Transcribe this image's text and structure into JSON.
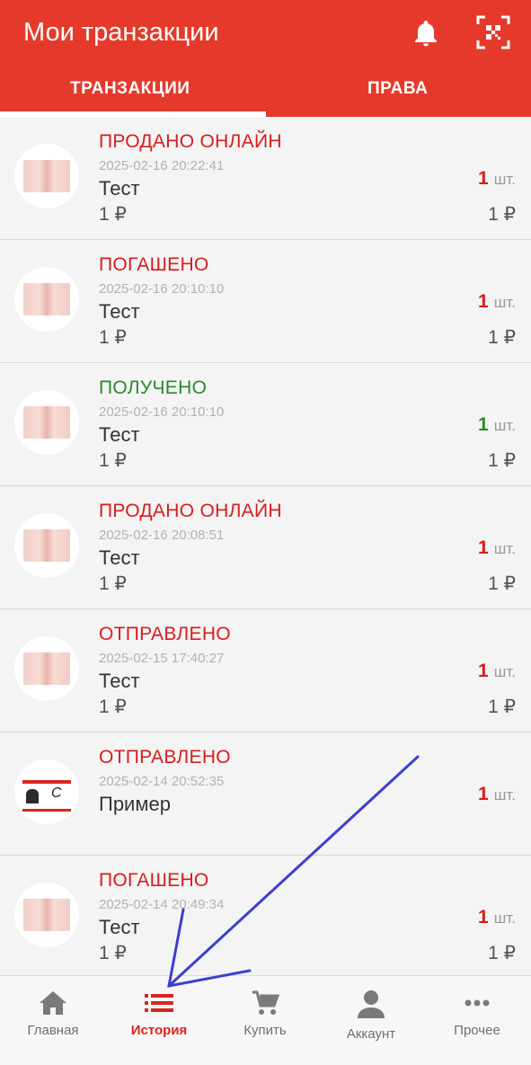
{
  "header": {
    "title": "Мои транзакции",
    "icons": [
      "bell-icon",
      "qr-scan-icon"
    ],
    "accent_color": "#e53a2b"
  },
  "tabs": [
    {
      "label": "ТРАНЗАКЦИИ",
      "active": true
    },
    {
      "label": "ПРАВА",
      "active": false
    }
  ],
  "transactions": [
    {
      "status": "ПРОДАНО ОНЛАЙН",
      "status_color": "red",
      "date": "2025-02-16 20:22:41",
      "name": "Тест",
      "price": "1 ₽",
      "qty": "1",
      "unit": "шт.",
      "total": "1 ₽",
      "thumb": "image"
    },
    {
      "status": "ПОГАШЕНО",
      "status_color": "red",
      "date": "2025-02-16 20:10:10",
      "name": "Тест",
      "price": "1 ₽",
      "qty": "1",
      "unit": "шт.",
      "total": "1 ₽",
      "thumb": "image"
    },
    {
      "status": "ПОЛУЧЕНО",
      "status_color": "green",
      "date": "2025-02-16 20:10:10",
      "name": "Тест",
      "price": "1 ₽",
      "qty": "1",
      "unit": "шт.",
      "total": "1 ₽",
      "thumb": "image"
    },
    {
      "status": "ПРОДАНО ОНЛАЙН",
      "status_color": "red",
      "date": "2025-02-16 20:08:51",
      "name": "Тест",
      "price": "1 ₽",
      "qty": "1",
      "unit": "шт.",
      "total": "1 ₽",
      "thumb": "image"
    },
    {
      "status": "ОТПРАВЛЕНО",
      "status_color": "red",
      "date": "2025-02-15 17:40:27",
      "name": "Тест",
      "price": "1 ₽",
      "qty": "1",
      "unit": "шт.",
      "total": "1 ₽",
      "thumb": "image"
    },
    {
      "status": "ОТПРАВЛЕНО",
      "status_color": "red",
      "date": "2025-02-14 20:52:35",
      "name": "Пример",
      "price": "",
      "qty": "1",
      "unit": "шт.",
      "total": "",
      "thumb": "banner"
    },
    {
      "status": "ПОГАШЕНО",
      "status_color": "red",
      "date": "2025-02-14 20:49:34",
      "name": "Тест",
      "price": "1 ₽",
      "qty": "1",
      "unit": "шт.",
      "total": "1 ₽",
      "thumb": "image"
    }
  ],
  "bottom_nav": [
    {
      "label": "Главная",
      "icon": "home-icon",
      "active": false
    },
    {
      "label": "История",
      "icon": "list-icon",
      "active": true
    },
    {
      "label": "Купить",
      "icon": "cart-icon",
      "active": false
    },
    {
      "label": "Аккаунт",
      "icon": "person-icon",
      "active": false
    },
    {
      "label": "Прочее",
      "icon": "more-dots-icon",
      "active": false
    }
  ],
  "annotation_arrow": {
    "color": "#3d3fd0"
  }
}
